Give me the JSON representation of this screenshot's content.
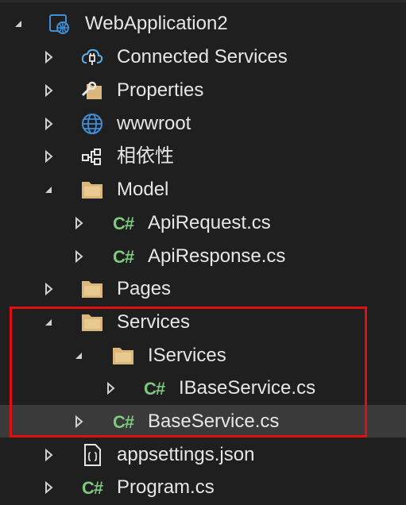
{
  "tree": {
    "project": {
      "label": "WebApplication2",
      "icon": "web-project-icon"
    },
    "items": [
      {
        "label": "Connected Services",
        "icon": "connected-services-icon"
      },
      {
        "label": "Properties",
        "icon": "properties-icon"
      },
      {
        "label": "wwwroot",
        "icon": "globe-icon"
      },
      {
        "label": "相依性",
        "icon": "dependencies-icon"
      },
      {
        "label": "Model",
        "icon": "folder-icon"
      },
      {
        "label": "ApiRequest.cs",
        "icon": "csharp-file-icon"
      },
      {
        "label": "ApiResponse.cs",
        "icon": "csharp-file-icon"
      },
      {
        "label": "Pages",
        "icon": "folder-icon"
      },
      {
        "label": "Services",
        "icon": "folder-icon"
      },
      {
        "label": "IServices",
        "icon": "folder-icon"
      },
      {
        "label": "IBaseService.cs",
        "icon": "csharp-file-icon"
      },
      {
        "label": "BaseService.cs",
        "icon": "csharp-file-icon"
      },
      {
        "label": "appsettings.json",
        "icon": "json-file-icon"
      },
      {
        "label": "Program.cs",
        "icon": "csharp-file-icon"
      }
    ],
    "cs_glyph": "C#"
  },
  "colors": {
    "background": "#1f1f1f",
    "selected_row": "#3a3a3a",
    "text": "#e6e6e6",
    "folder": "#dcb67a",
    "csharp": "#7dc97d",
    "globe": "#3f8fd8",
    "highlight_border": "#e01010"
  }
}
